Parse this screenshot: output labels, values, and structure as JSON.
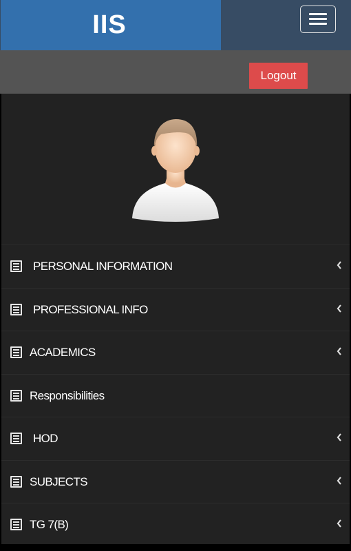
{
  "header": {
    "brand": "IIS",
    "menu_icon": "hamburger-menu-icon",
    "colors": {
      "brand_bg": "#3370ad",
      "nav_bg": "#374c64"
    }
  },
  "userbar": {
    "logout_label": "Logout",
    "logout_color": "#dd4b4b"
  },
  "sidebar": {
    "avatar_icon": "user-avatar-icon",
    "items": [
      {
        "label": "PERSONAL INFORMATION",
        "icon": "list-icon",
        "has_chevron": true
      },
      {
        "label": "PROFESSIONAL INFO",
        "icon": "list-icon",
        "has_chevron": true
      },
      {
        "label": "ACADEMICS",
        "icon": "list-icon",
        "has_chevron": true
      },
      {
        "label": "Responsibilities",
        "icon": "list-icon",
        "has_chevron": false
      },
      {
        "label": "HOD",
        "icon": "list-icon",
        "has_chevron": true
      },
      {
        "label": "SUBJECTS",
        "icon": "list-icon",
        "has_chevron": true
      },
      {
        "label": "TG 7(B)",
        "icon": "list-icon",
        "has_chevron": true
      }
    ]
  }
}
